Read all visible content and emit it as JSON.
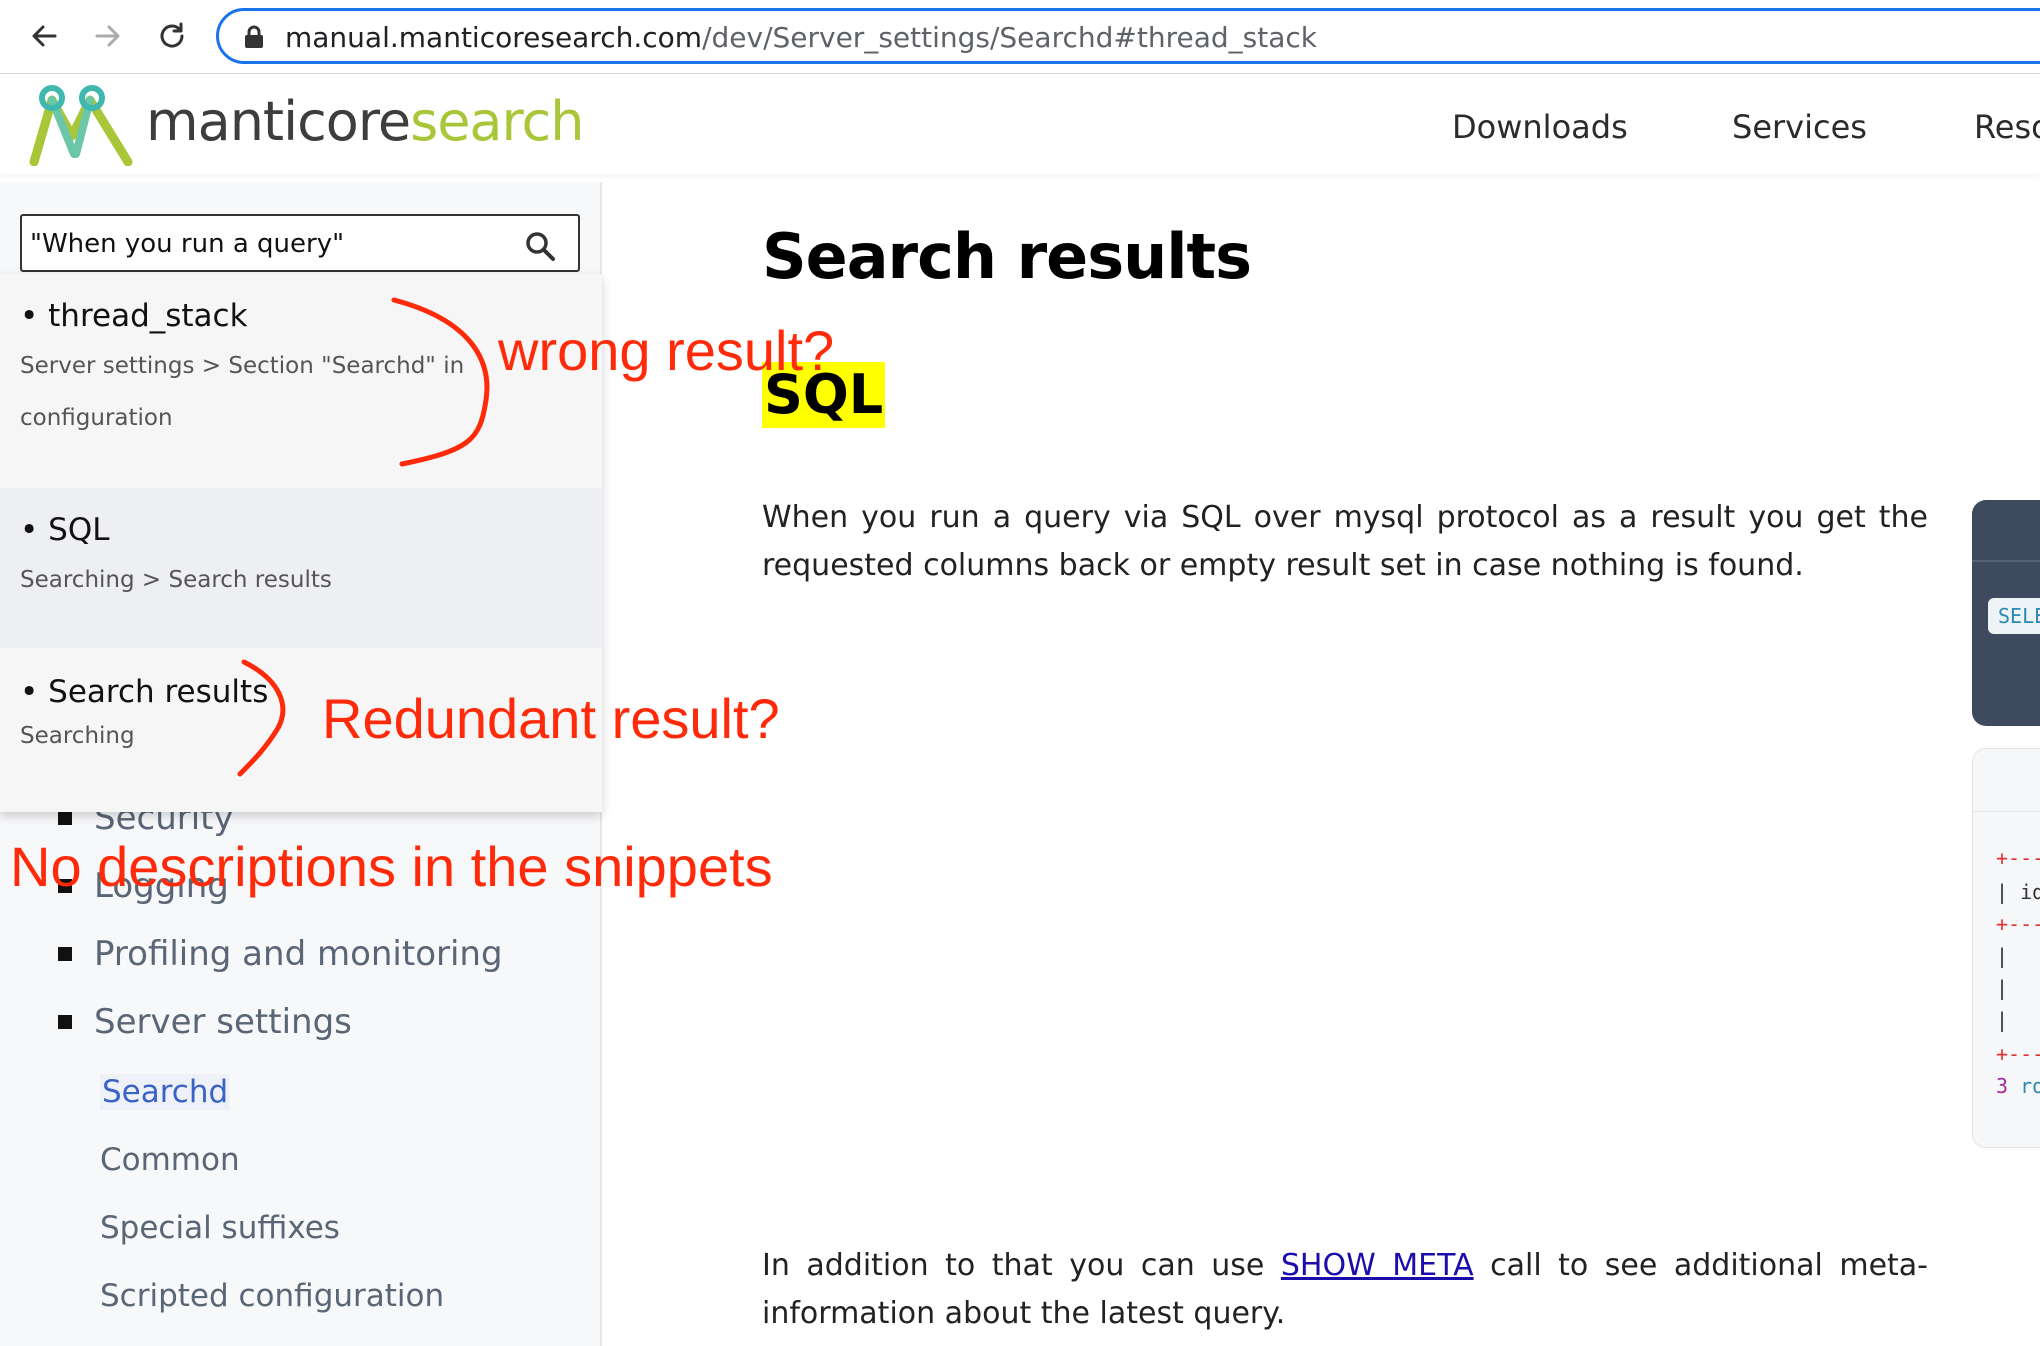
{
  "browser": {
    "url_host": "manual.manticoresearch.com",
    "url_path": "/dev/Server_settings/Searchd#thread_stack",
    "icons": [
      "back-arrow-icon",
      "forward-arrow-icon",
      "reload-icon",
      "lock-icon"
    ]
  },
  "site": {
    "logo_part1": "manticore",
    "logo_part2": "search",
    "nav": [
      "Downloads",
      "Services",
      "Reso"
    ],
    "brand_green": "#a9c639",
    "brand_dark": "#3d3d3d"
  },
  "sidebar": {
    "search_value": "\"When you run a query\"",
    "search_icon": "magnifier-icon",
    "results": [
      {
        "title": "• thread_stack",
        "path_line1": "Server settings > Section \"Searchd\" in",
        "path_line2": "configuration"
      },
      {
        "title": "• SQL",
        "path_line1": "Searching > Search results"
      },
      {
        "title": "• Search results",
        "path_line1": "Searching"
      }
    ],
    "tree": [
      "Security",
      "Logging",
      "Profiling and monitoring",
      "Server settings"
    ],
    "sub_items": [
      "Searchd",
      "Common",
      "Special suffixes",
      "Scripted configuration"
    ]
  },
  "main": {
    "title": "Search results",
    "section": "SQL",
    "para1": "When you run a query via SQL over mysql protocol as a result you get the requested columns back or empty result set in case nothing is found.",
    "para2_before": "In addition to that you can use ",
    "para2_link": "SHOW META",
    "para2_after": " call to see additional meta-information about the latest query."
  },
  "code": {
    "tag": "SELE",
    "lines": [
      "+---",
      "| id",
      "+---",
      "|",
      "|",
      "|",
      "+---"
    ],
    "row_count_num": "3",
    "row_count_word": "ro"
  },
  "annotations": {
    "wrong": "wrong result?",
    "redundant": "Redundant result?",
    "no_desc": "No descriptions in the snippets",
    "color": "#ff2a0a"
  }
}
